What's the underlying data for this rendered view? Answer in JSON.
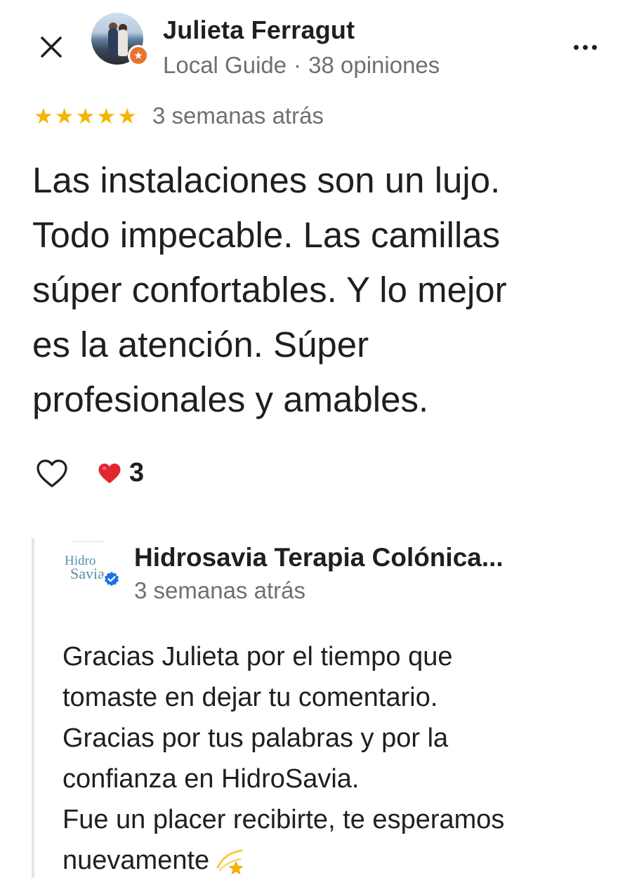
{
  "reviewer": {
    "name": "Julieta Ferragut",
    "badge": "Local Guide",
    "separator": "·",
    "reviews_count": "38 opiniones"
  },
  "review": {
    "rating": 5,
    "stars": "★★★★★",
    "date": "3 semanas atrás",
    "text": "Las instalaciones son un lujo.\nTodo impecable. Las camillas\nsúper confortables. Y lo mejor\nes la atención. Súper\nprofesionales y amables."
  },
  "reactions": {
    "count": "3"
  },
  "owner_reply": {
    "name": "Hidrosavia Terapia Colónica...",
    "date": "3 semanas atrás",
    "logo_text_1": "Hidro",
    "logo_text_2": "Savia",
    "text": "Gracias Julieta por el tiempo que\ntomaste en dejar tu comentario.\nGracias por tus palabras y por la\nconfianza en HidroSavia.\nFue un placer recibirte, te esperamos\nnuevamente"
  },
  "colors": {
    "star": "#f4b400",
    "guide_badge": "#e8732e",
    "verified": "#1a73e8",
    "secondary_text": "#6f6f6f"
  },
  "icons": {
    "close": "close-icon",
    "more": "more-vert-icon",
    "like": "heart-outline-icon",
    "reaction": "red-heart-icon",
    "verified": "verified-check-icon",
    "sparkle": "dizzy-star-emoji"
  }
}
